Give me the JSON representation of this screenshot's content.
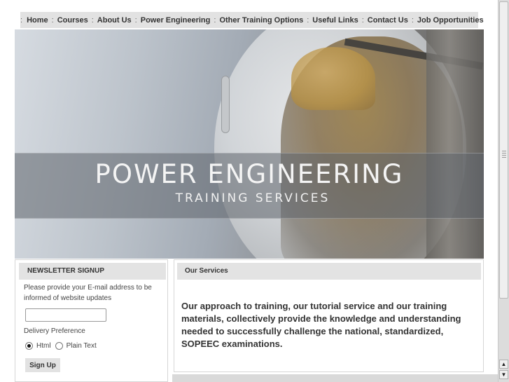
{
  "nav": {
    "items": [
      {
        "label": "Home"
      },
      {
        "label": "Courses"
      },
      {
        "label": "About Us"
      },
      {
        "label": "Power Engineering"
      },
      {
        "label": "Other Training Options"
      },
      {
        "label": "Useful Links"
      },
      {
        "label": "Contact Us"
      },
      {
        "label": "Job Opportunities"
      }
    ],
    "separator": ":"
  },
  "hero": {
    "title": "POWER ENGINEERING",
    "subtitle": "TRAINING SERVICES"
  },
  "newsletter": {
    "heading": "NEWSLETTER SIGNUP",
    "description": "Please provide your E-mail address to be informed of website updates",
    "email_value": "",
    "delivery_label": "Delivery Preference",
    "options": [
      {
        "label": "Html",
        "checked": true
      },
      {
        "label": "Plain Text",
        "checked": false
      }
    ],
    "button_label": "Sign Up"
  },
  "services": {
    "heading": "Our Services",
    "body": "Our approach to training, our tutorial service and our training materials, collectively provide the knowledge and understanding needed to successfully challenge the national, standardized, SOPEEC examinations."
  },
  "scrollbar": {
    "up_icon": "arrow-up-icon",
    "down_icon": "arrow-down-icon"
  }
}
